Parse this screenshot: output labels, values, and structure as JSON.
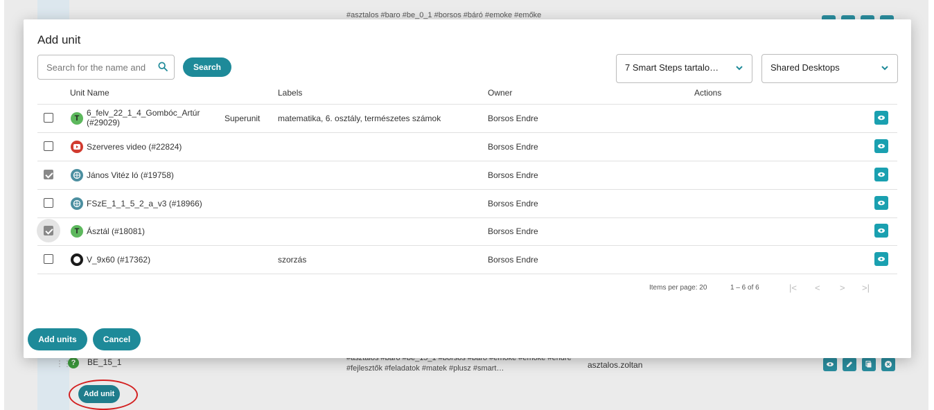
{
  "background": {
    "top_labels": "#asztalos #baro #be_0_1 #borsos #báró #emoke #emőke",
    "row_name": "BE_15_1",
    "row_labels": "#asztalos #baro #be_15_1 #borsos #baro #emoke #emoke #endre #fejlesztők #feladatok #matek #plusz #smart…",
    "row_owner": "asztalos.zoltan",
    "add_unit_label": "Add unit"
  },
  "dialog": {
    "title": "Add unit",
    "search_placeholder": "Search for the name and",
    "search_button": "Search",
    "select1": "7 Smart Steps tartalo…",
    "select2": "Shared Desktops",
    "columns": {
      "name": "Unit Name",
      "labels": "Labels",
      "owner": "Owner",
      "actions": "Actions"
    },
    "rows": [
      {
        "name": "6_felv_22_1_4_Gombóc_Artúr",
        "name2": "(#29029)",
        "type": "Superunit",
        "labels": "matematika, 6. osztály, természetes számok",
        "owner": "Borsos Endre"
      },
      {
        "name": "Szerveres video (#22824)",
        "labels": "",
        "owner": "Borsos Endre"
      },
      {
        "name": "János Vitéz ló (#19758)",
        "labels": "",
        "owner": "Borsos Endre"
      },
      {
        "name": "FSzE_1_1_5_2_a_v3 (#18966)",
        "labels": "",
        "owner": "Borsos Endre"
      },
      {
        "name": "Ásztál (#18081)",
        "labels": "",
        "owner": "Borsos Endre"
      },
      {
        "name": "V_9x60 (#17362)",
        "labels": "szorzás",
        "owner": "Borsos Endre"
      }
    ],
    "icon_letter": "T",
    "pagination": {
      "items_per_page": "Items per page: 20",
      "range": "1 – 6 of 6",
      "first": "|<",
      "prev": "<",
      "next": ">",
      "last": ">|"
    },
    "add_units_button": "Add units",
    "cancel_button": "Cancel"
  },
  "colors": {
    "accent": "#1e8a99",
    "eye": "#1aa0b0",
    "highlight": "#d32020"
  },
  "icons": [
    "search-icon",
    "chevron-down-icon",
    "eye-icon",
    "youtube-icon",
    "gear-icon",
    "circle-icon",
    "help-icon"
  ]
}
